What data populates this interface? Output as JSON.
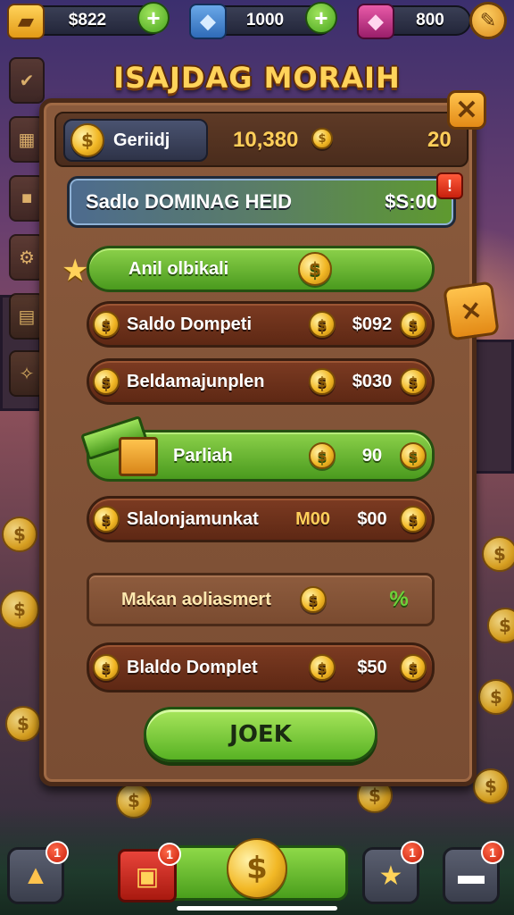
{
  "topbar": {
    "resources": [
      {
        "icon": "gold-bar-icon",
        "value": "$822"
      },
      {
        "icon": "gem-box-icon",
        "value": "1000"
      },
      {
        "icon": "ruby-gem-icon",
        "value": "800"
      }
    ]
  },
  "title": "ISAJDAG MORAIH",
  "panel": {
    "currency_label": "Geriidj",
    "top_value": "10,380",
    "top_count": "20",
    "balance": {
      "label": "Sadlo DOMINAG HEID",
      "value": "$S:00",
      "badge": "!"
    },
    "rows": [
      {
        "label": "Anil olbikali",
        "mid": "",
        "amount": "",
        "style": "green-header"
      },
      {
        "label": "Saldo Dompeti",
        "mid": "",
        "amount": "$092"
      },
      {
        "label": "Beldamajunplen",
        "mid": "",
        "amount": "$030"
      },
      {
        "label": "Parliah",
        "mid": "",
        "amount": "90"
      },
      {
        "label": "Slalonjamunkat",
        "mid": "M00",
        "amount": "$00"
      },
      {
        "label": "Makan aoliasmert",
        "mid": "",
        "amount": "%"
      },
      {
        "label": "Blaldo Domplet",
        "mid": "",
        "amount": "$50"
      }
    ],
    "action_label": "JOEK"
  },
  "bottom": {
    "badges": [
      "1",
      "1",
      "1",
      "1"
    ]
  },
  "colors": {
    "accent_gold": "#ffcf5a",
    "button_green": "#58b224",
    "panel_brown": "#7a4d33",
    "alert_red": "#c8210e"
  }
}
